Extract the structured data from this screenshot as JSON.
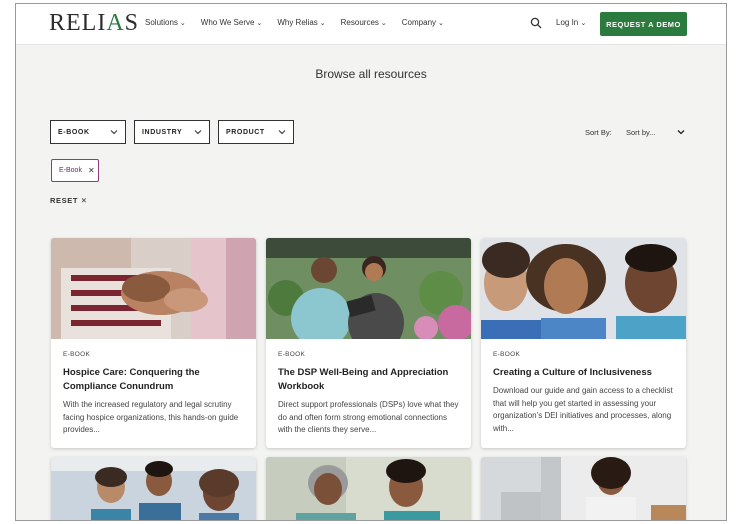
{
  "header": {
    "logo": {
      "part1": "RELI",
      "part2": "A",
      "part3": "S"
    },
    "nav": [
      "Solutions",
      "Who We Serve",
      "Why Relias",
      "Resources",
      "Company"
    ],
    "login": "Log In",
    "demo_button": "REQUEST A DEMO"
  },
  "main": {
    "title": "Browse all resources",
    "filters": [
      "E-BOOK",
      "INDUSTRY",
      "PRODUCT"
    ],
    "sort_label": "Sort By:",
    "sort_value": "Sort by...",
    "active_chip": "E-Book",
    "reset": "RESET"
  },
  "cards": [
    {
      "type": "E-BOOK",
      "title": "Hospice Care: Conquering the Compliance Conundrum",
      "desc": "With the increased regulatory and legal scrutiny facing hospice organizations, this hands-on guide provides..."
    },
    {
      "type": "E-BOOK",
      "title": "The DSP Well-Being and Appreciation Workbook",
      "desc": "Direct support professionals (DSPs) love what they do and often form strong emotional connections with the clients they serve..."
    },
    {
      "type": "E-BOOK",
      "title": "Creating a Culture of Inclusiveness",
      "desc": "Download our guide and gain access to a checklist that will help you get started in assessing your organization’s DEI initiatives and processes, along with..."
    }
  ],
  "colors": {
    "brand_green": "#2b7a3e",
    "chip_purple": "#8a3e7a",
    "page_bg": "#f3f3f1"
  }
}
